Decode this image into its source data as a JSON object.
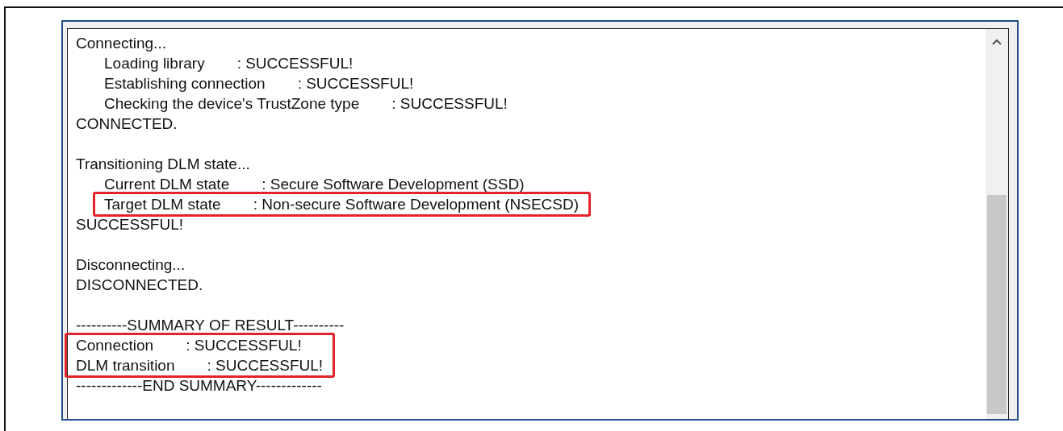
{
  "console": {
    "lines": [
      {
        "kind": "text",
        "text": "Connecting...",
        "indented": false,
        "highlighted": false
      },
      {
        "kind": "field",
        "label": "Loading library",
        "value": ": SUCCESSFUL!",
        "indented": true,
        "highlighted": false
      },
      {
        "kind": "field",
        "label": "Establishing connection",
        "value": ": SUCCESSFUL!",
        "indented": true,
        "highlighted": false
      },
      {
        "kind": "field",
        "label": "Checking the device's TrustZone type",
        "value": ": SUCCESSFUL!",
        "indented": true,
        "highlighted": false
      },
      {
        "kind": "text",
        "text": "CONNECTED.",
        "indented": false,
        "highlighted": false
      },
      {
        "kind": "blank"
      },
      {
        "kind": "text",
        "text": "Transitioning DLM state...",
        "indented": false,
        "highlighted": false
      },
      {
        "kind": "field",
        "label": "Current DLM state",
        "value": ": Secure Software Development (SSD)",
        "indented": true,
        "highlighted": false
      },
      {
        "kind": "field",
        "label": "Target DLM state",
        "value": ": Non-secure Software Development (NSECSD)",
        "indented": true,
        "highlighted": true
      },
      {
        "kind": "text",
        "text": "SUCCESSFUL!",
        "indented": false,
        "highlighted": false
      },
      {
        "kind": "blank"
      },
      {
        "kind": "text",
        "text": "Disconnecting...",
        "indented": false,
        "highlighted": false
      },
      {
        "kind": "text",
        "text": "DISCONNECTED.",
        "indented": false,
        "highlighted": false
      },
      {
        "kind": "blank"
      },
      {
        "kind": "text",
        "text": "----------SUMMARY OF RESULT----------",
        "indented": false,
        "highlighted": false
      },
      {
        "kind": "field",
        "label": "Connection",
        "value": ": SUCCESSFUL!",
        "indented": false,
        "highlighted": true
      },
      {
        "kind": "field",
        "label": "DLM transition",
        "value": ": SUCCESSFUL!",
        "indented": false,
        "highlighted": true
      },
      {
        "kind": "text",
        "text": "-------------END SUMMARY-------------",
        "indented": false,
        "highlighted": false
      }
    ]
  }
}
